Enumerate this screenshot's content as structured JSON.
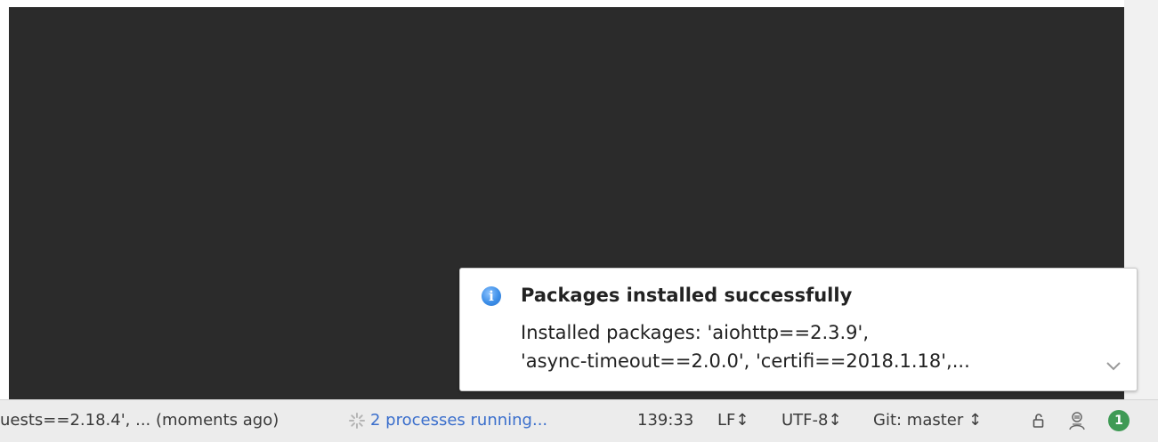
{
  "notification": {
    "icon": "info-icon",
    "icon_glyph": "i",
    "title": "Packages installed successfully",
    "body_line1": "Installed packages: 'aiohttp==2.3.9',",
    "body_line2": "'async-timeout==2.0.0', 'certifi==2018.1.18',...",
    "expand_icon": "chevron-down-icon"
  },
  "statusbar": {
    "event_text": "uests==2.18.4', ... (moments ago)",
    "processes_text": "2 processes running...",
    "caret_position": "139:33",
    "line_separator": "LF↕",
    "encoding": "UTF-8↕",
    "git_branch": "Git: master ↕",
    "event_log_count": "1",
    "colors": {
      "processes_link": "#3b6fcc",
      "event_log_badge": "#3f9a55"
    }
  },
  "colors": {
    "editor_background": "#2b2b2b",
    "info_icon": "#3d8fe8"
  }
}
